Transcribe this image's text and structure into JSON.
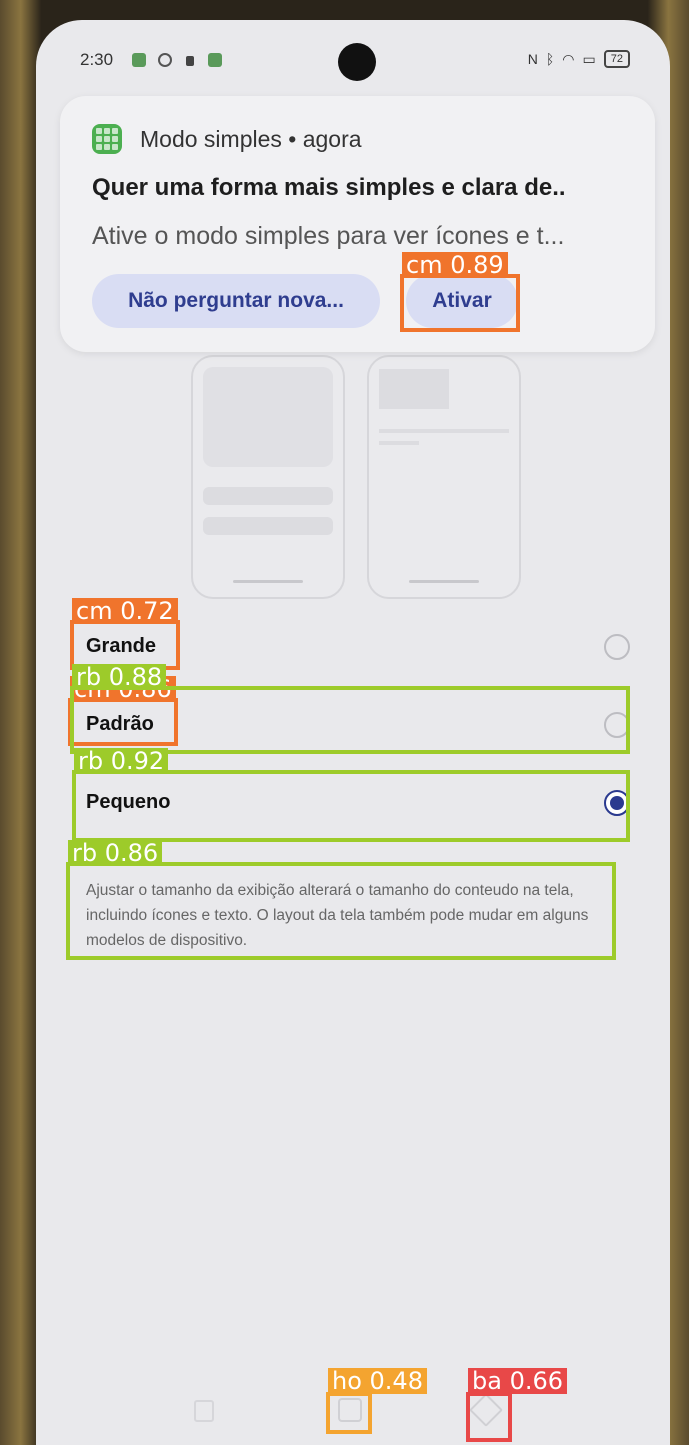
{
  "status_bar": {
    "time": "2:30",
    "battery": "72"
  },
  "notification": {
    "app_name": "Modo simples • agora",
    "title": "Quer uma forma mais simples e clara de..",
    "body": "Ative o modo simples para ver ícones e t...",
    "decline_label": "Não perguntar nova...",
    "activate_label": "Ativar"
  },
  "options": [
    {
      "label": "Grande",
      "selected": false
    },
    {
      "label": "Padrão",
      "selected": false
    },
    {
      "label": "Pequeno",
      "selected": true
    }
  ],
  "description": "Ajustar o tamanho da exibição alterará o tamanho do conteudo na tela, incluindo ícones e texto. O layout da tela também pode mudar em alguns modelos de dispositivo.",
  "detections": [
    {
      "label": "cm 0.89",
      "class": "cm"
    },
    {
      "label": "cm 0.72",
      "class": "cm"
    },
    {
      "label": "rb 0.88",
      "class": "rb"
    },
    {
      "label": "cm 0.86",
      "class": "cm"
    },
    {
      "label": "rb 0.92",
      "class": "rb"
    },
    {
      "label": "rb 0.86",
      "class": "rb"
    },
    {
      "label": "ho 0.48",
      "class": "ho"
    },
    {
      "label": "ba 0.66",
      "class": "ba"
    }
  ],
  "colors": {
    "accent": "#2b3a8f",
    "button_bg": "#d9ddf3",
    "cm": "#f0742c",
    "rb": "#9dcb2a",
    "ho": "#f4a430",
    "ba": "#e84848"
  }
}
